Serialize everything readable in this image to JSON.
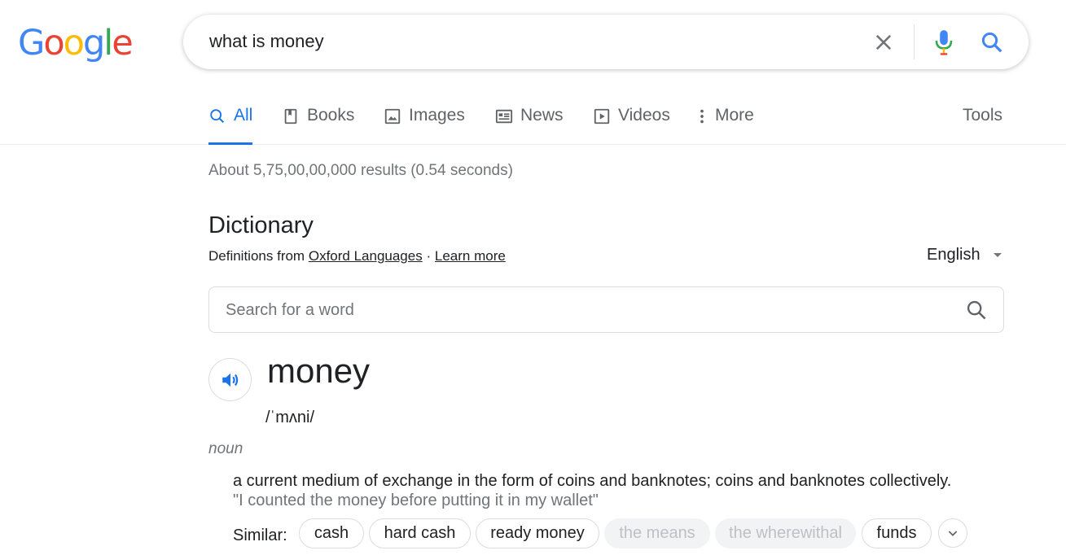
{
  "logo": {
    "letters": [
      "G",
      "o",
      "o",
      "g",
      "l",
      "e"
    ],
    "colors": [
      "#4285f4",
      "#ea4335",
      "#fbbc05",
      "#4285f4",
      "#34a853",
      "#ea4335"
    ]
  },
  "search": {
    "query": "what is money",
    "clear_icon": "close-icon",
    "mic_icon": "microphone-icon",
    "search_icon": "search-icon"
  },
  "tabs": [
    {
      "label": "All",
      "icon": "search-icon",
      "active": true
    },
    {
      "label": "Books",
      "icon": "book-icon",
      "active": false
    },
    {
      "label": "Images",
      "icon": "image-icon",
      "active": false
    },
    {
      "label": "News",
      "icon": "news-icon",
      "active": false
    },
    {
      "label": "Videos",
      "icon": "video-icon",
      "active": false
    },
    {
      "label": "More",
      "icon": "more-vert-icon",
      "active": false
    }
  ],
  "tools_label": "Tools",
  "result_stats": "About 5,75,00,00,000 results (0.54 seconds)",
  "dictionary": {
    "title": "Dictionary",
    "source_prefix": "Definitions from",
    "source_link": "Oxford Languages",
    "separator": "·",
    "learn_more": "Learn more",
    "language": "English",
    "search_placeholder": "Search for a word",
    "word": "money",
    "phonetic": "/ˈmʌni/",
    "part_of_speech": "noun",
    "definition": "a current medium of exchange in the form of coins and banknotes; coins and banknotes collectively.",
    "example": "\"I counted the money before putting it in my wallet\"",
    "similar_label": "Similar:",
    "similar": [
      {
        "label": "cash",
        "faded": false
      },
      {
        "label": "hard cash",
        "faded": false
      },
      {
        "label": "ready money",
        "faded": false
      },
      {
        "label": "the means",
        "faded": true
      },
      {
        "label": "the wherewithal",
        "faded": true
      },
      {
        "label": "funds",
        "faded": false
      }
    ]
  },
  "accent_color": "#1a73e8"
}
